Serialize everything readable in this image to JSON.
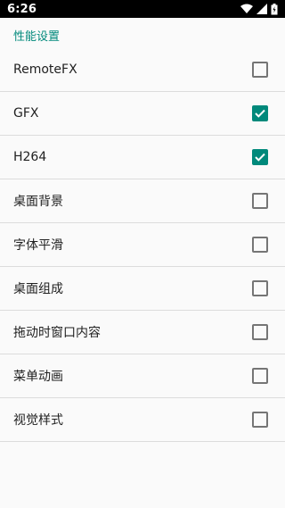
{
  "status_bar": {
    "time": "6:26",
    "icons": [
      "wifi-icon",
      "cellular-signal-icon",
      "battery-charging-icon"
    ]
  },
  "section": {
    "title": "性能设置"
  },
  "preferences": [
    {
      "label": "RemoteFX",
      "checked": false
    },
    {
      "label": "GFX",
      "checked": true
    },
    {
      "label": "H264",
      "checked": true
    },
    {
      "label": "桌面背景",
      "checked": false
    },
    {
      "label": "字体平滑",
      "checked": false
    },
    {
      "label": "桌面组成",
      "checked": false
    },
    {
      "label": "拖动时窗口内容",
      "checked": false
    },
    {
      "label": "菜单动画",
      "checked": false
    },
    {
      "label": "视觉样式",
      "checked": false
    }
  ],
  "colors": {
    "accent": "#00897b",
    "divider": "#dcdcdc",
    "background": "#fafafa",
    "status_bar": "#000000"
  }
}
